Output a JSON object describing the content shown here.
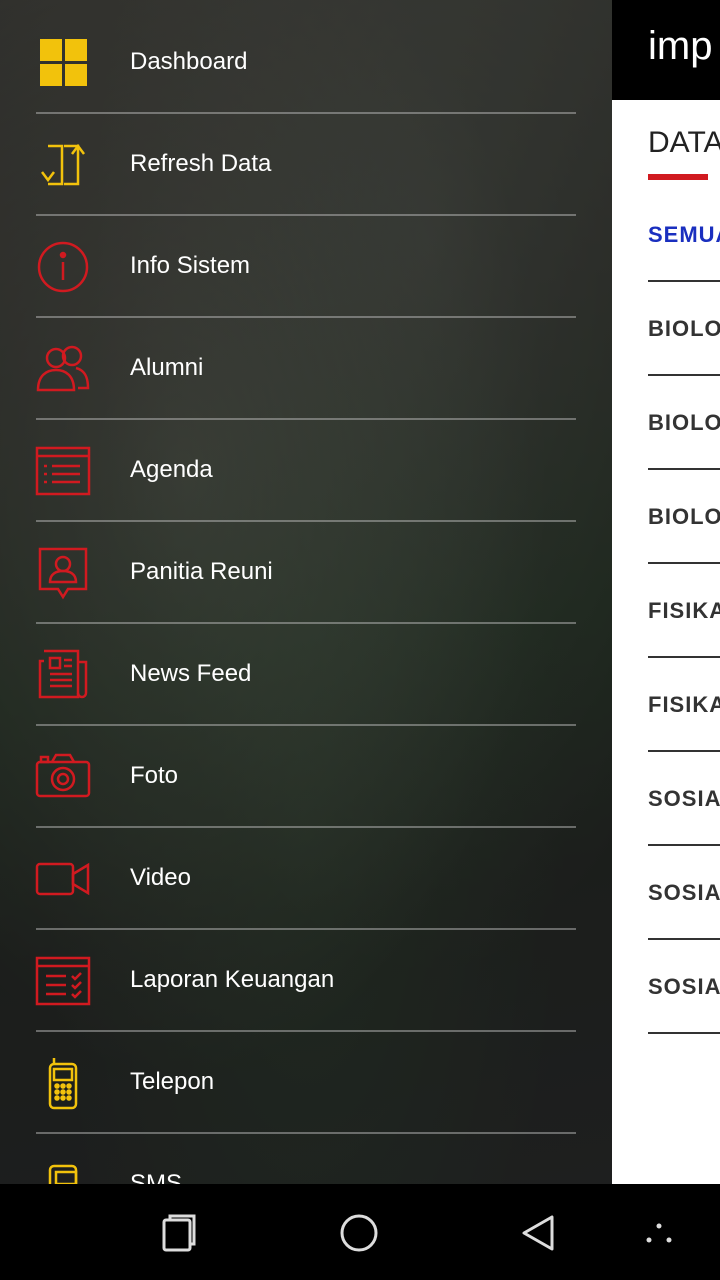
{
  "main": {
    "title": "imp",
    "tab": "DATA",
    "items": [
      {
        "label": "SEMUA",
        "active": true
      },
      {
        "label": "BIOLO"
      },
      {
        "label": "BIOLO"
      },
      {
        "label": "BIOLO"
      },
      {
        "label": "FISIKA"
      },
      {
        "label": "FISIKA"
      },
      {
        "label": "SOSIA"
      },
      {
        "label": "SOSIA"
      },
      {
        "label": "SOSIA"
      }
    ]
  },
  "drawer": {
    "items": [
      {
        "label": "Dashboard",
        "icon": "dashboard-icon"
      },
      {
        "label": "Refresh Data",
        "icon": "refresh-icon"
      },
      {
        "label": "Info Sistem",
        "icon": "info-icon"
      },
      {
        "label": "Alumni",
        "icon": "people-icon"
      },
      {
        "label": "Agenda",
        "icon": "agenda-icon"
      },
      {
        "label": "Panitia Reuni",
        "icon": "contact-icon"
      },
      {
        "label": "News Feed",
        "icon": "newspaper-icon"
      },
      {
        "label": "Foto",
        "icon": "camera-icon"
      },
      {
        "label": "Video",
        "icon": "video-icon"
      },
      {
        "label": "Laporan Keuangan",
        "icon": "checklist-icon"
      },
      {
        "label": "Telepon",
        "icon": "phone-icon"
      },
      {
        "label": "SMS",
        "icon": "sms-icon"
      }
    ]
  },
  "colors": {
    "accent_red": "#d11a20",
    "accent_yellow": "#f2c20c",
    "active_blue": "#1a2fbf"
  }
}
